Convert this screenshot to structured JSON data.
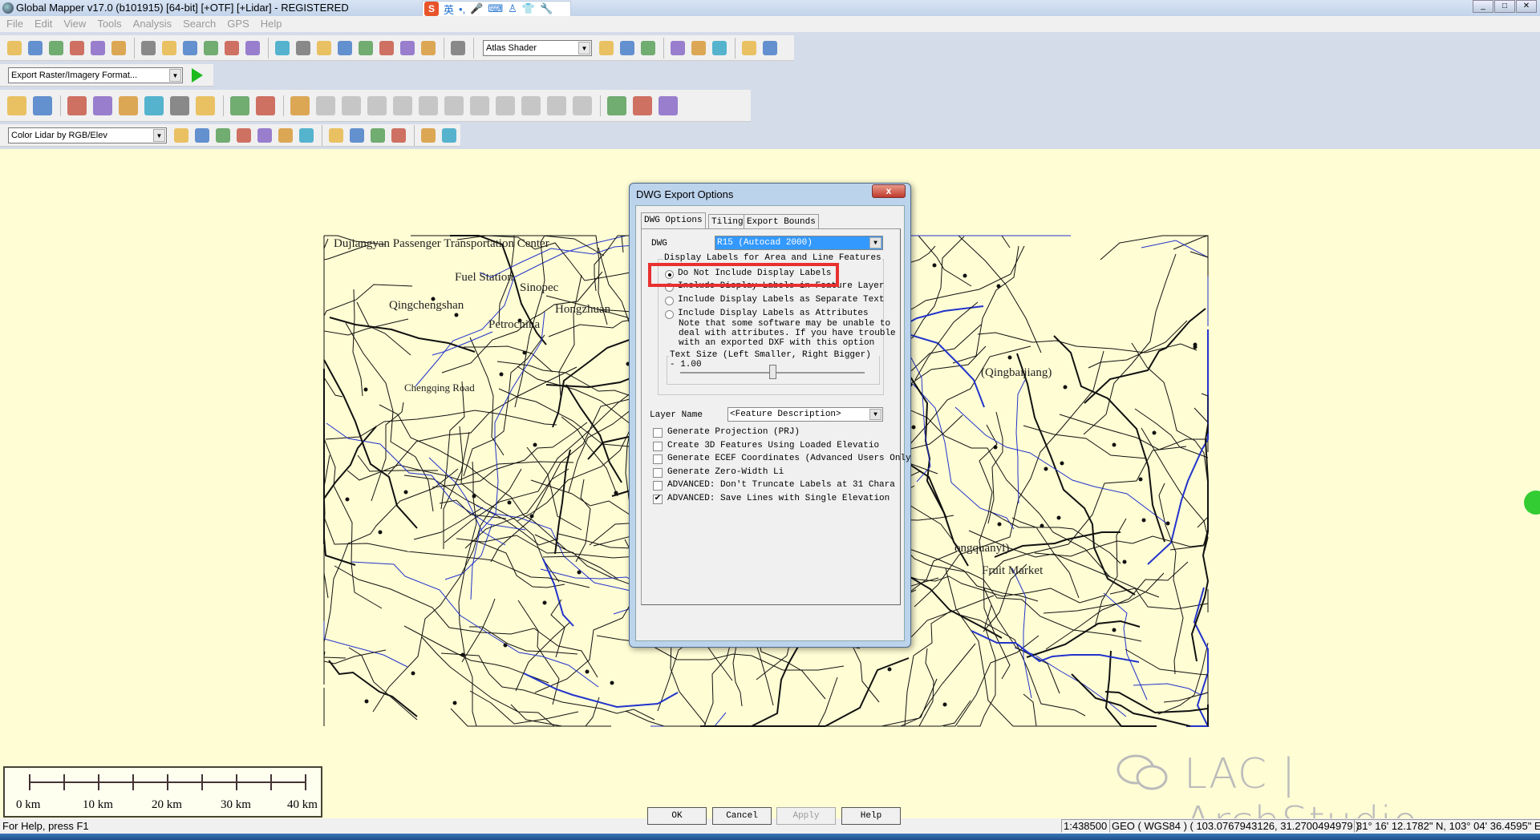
{
  "window": {
    "title": "Global Mapper v17.0 (b101915) [64-bit] [+OTF] [+Lidar] - REGISTERED",
    "controls": [
      "_",
      "□",
      "✕"
    ]
  },
  "ime": {
    "logo": "S",
    "items": [
      "英",
      "•,",
      "🎤",
      "⌨",
      "♙",
      "👕",
      "🔧"
    ]
  },
  "menu": [
    "File",
    "Edit",
    "View",
    "Tools",
    "Analysis",
    "Search",
    "GPS",
    "Help"
  ],
  "toolbar1": {
    "icons": [
      "open-icon",
      "save-icon",
      "globe-icon",
      "layers-icon",
      "config-icon",
      "tools-icon",
      "|",
      "zoom-in-icon",
      "zoom-out-icon",
      "zoom-extents-icon",
      "home-icon",
      "refresh-icon",
      "grid-icon",
      "|",
      "zoom-tool-icon",
      "pan-icon",
      "measure-icon",
      "info-icon",
      "path-profile-icon",
      "tower-icon",
      "digitize-icon",
      "filter-icon",
      "|",
      "binoculars-icon"
    ],
    "shader": "Atlas Shader",
    "icons2": [
      "shader-1-icon",
      "shader-3d-icon",
      "shader-2-icon",
      "|",
      "export-icon",
      "print-icon",
      "sparkle-icon",
      "|",
      "gps-icon",
      "north-arrow-icon"
    ]
  },
  "toolbar2": {
    "export_format": "Export Raster/Imagery Format..."
  },
  "toolbar3": {
    "icons": [
      "create-area-icon",
      "create-area-rect-icon",
      "|",
      "create-line-icon",
      "create-line-curve-icon",
      "create-rect-icon",
      "cogo-icon",
      "create-circle-icon",
      "create-grid-icon",
      "|",
      "create-points-icon",
      "create-point-icon",
      "|",
      "line-edit-icon",
      "edit-disabled-1-icon",
      "edit-disabled-2-icon",
      "edit-disabled-3-icon",
      "edit-disabled-4-icon",
      "edit-disabled-5-icon",
      "edit-disabled-6-icon",
      "edit-disabled-7-icon",
      "edit-disabled-8-icon",
      "edit-disabled-9-icon",
      "edit-disabled-10-icon",
      "edit-disabled-11-icon",
      "|",
      "undo-edit-1-icon",
      "undo-edit-2-icon",
      "undo-edit-3-icon"
    ]
  },
  "toolbar4": {
    "lidar_color": "Color Lidar by RGB/Elev",
    "icons": [
      "ground-class-icon",
      "low-veg-icon",
      "med-veg-icon",
      "high-veg-icon",
      "building-icon",
      "powerline-icon",
      "water-icon",
      "|",
      "auto-noise-icon",
      "auto-ground-icon",
      "auto-classify-icon",
      "classify-area-icon",
      "|",
      "lidar-filter-icon",
      "lidar-grid-icon"
    ]
  },
  "colors": {
    "map_bg": "#fffdd4",
    "accent_highlight": "#e83030",
    "selected": "#3399ff"
  },
  "map": {
    "labels": [
      {
        "text": "Dujiangyan Passenger Transportation Center"
      },
      {
        "text": "Fuel Station"
      },
      {
        "text": "Sinopec"
      },
      {
        "text": "Qingchengshan"
      },
      {
        "text": "Hongzhuan"
      },
      {
        "text": "Petrochina"
      },
      {
        "text": "Chengqing Road"
      },
      {
        "text": "(Qingbaijiang)"
      },
      {
        "text": "ongquanyi)"
      },
      {
        "text": "Fruit Market"
      }
    ]
  },
  "scalebar": {
    "labels": [
      "0 km",
      "10 km",
      "20 km",
      "30 km",
      "40 km"
    ]
  },
  "watermark": "LAC | ArchStudio",
  "status": {
    "help": "For Help, press F1",
    "scale": "1:438500",
    "projection": "GEO ( WGS84 ) ( 103.0767943126, 31.2700494979 )",
    "dms": "31° 16' 12.1782\" N, 103° 04' 36.4595\" E"
  },
  "dialog": {
    "title": "DWG Export Options",
    "close": "x",
    "tabs": [
      "DWG Options",
      "Tiling",
      "Export Bounds"
    ],
    "dwg_label": "DWG",
    "dwg_version": "R15 (Autocad 2000)",
    "labels_group": "Display Labels for Area and Line Features",
    "radios": [
      {
        "label": "Do Not Include Display Labels",
        "checked": true
      },
      {
        "label": "Include Display Labels in Feature Layer",
        "checked": false
      },
      {
        "label": "Include Display Labels as Separate Text",
        "checked": false
      },
      {
        "label": "Include Display Labels as Attributes",
        "checked": false
      }
    ],
    "note": [
      "Note that some software may be unable to",
      "deal with attributes. If you have trouble",
      "with an exported DXF with this option"
    ],
    "text_size_label": "Text Size (Left Smaller, Right Bigger) - 1.00",
    "text_size_value": 1.0,
    "layer_name_label": "Layer Name",
    "layer_name_value": "<Feature Description>",
    "checkboxes": [
      {
        "label": "Generate Projection (PRJ)",
        "checked": false
      },
      {
        "label": "Create 3D Features Using Loaded Elevatio",
        "checked": false
      },
      {
        "label": "Generate ECEF Coordinates (Advanced Users Only",
        "checked": false
      },
      {
        "label": "Generate Zero-Width Li",
        "checked": false
      },
      {
        "label": "ADVANCED: Don't Truncate Labels at 31 Chara",
        "checked": false
      },
      {
        "label": "ADVANCED: Save Lines with Single Elevation",
        "checked": true
      }
    ],
    "buttons": {
      "ok": "OK",
      "cancel": "Cancel",
      "apply": "Apply",
      "help": "Help"
    }
  }
}
